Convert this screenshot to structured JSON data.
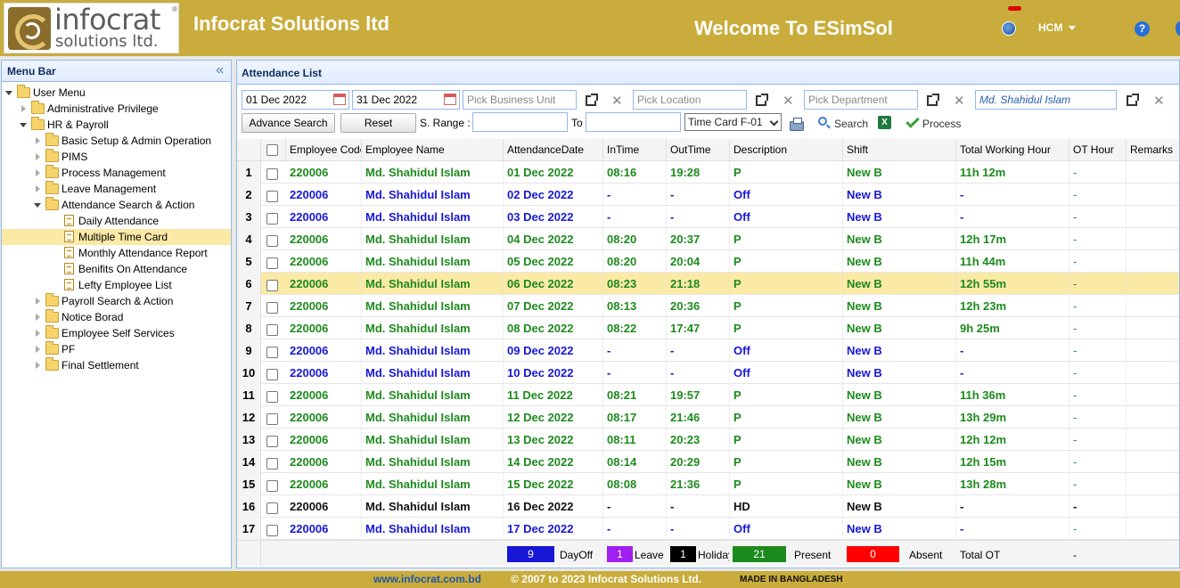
{
  "header": {
    "logo_line1": "infocrat",
    "logo_line2": "solutions ltd.",
    "logo_reg": "®",
    "company": "Infocrat Solutions ltd",
    "welcome": "Welcome To ESimSol",
    "user": "HCM",
    "help": "?"
  },
  "sidebar": {
    "title": "Menu Bar",
    "collapse": "«",
    "items": [
      {
        "label": "User Menu",
        "level": 0,
        "type": "folder",
        "state": "open"
      },
      {
        "label": "Administrative Privilege",
        "level": 1,
        "type": "folder",
        "state": "closed"
      },
      {
        "label": "HR & Payroll",
        "level": 1,
        "type": "folder",
        "state": "open"
      },
      {
        "label": "Basic Setup & Admin Operation",
        "level": 2,
        "type": "folder",
        "state": "closed"
      },
      {
        "label": "PIMS",
        "level": 2,
        "type": "folder",
        "state": "closed"
      },
      {
        "label": "Process Management",
        "level": 2,
        "type": "folder",
        "state": "closed"
      },
      {
        "label": "Leave Management",
        "level": 2,
        "type": "folder",
        "state": "closed"
      },
      {
        "label": "Attendance Search & Action",
        "level": 2,
        "type": "folder",
        "state": "open"
      },
      {
        "label": "Daily Attendance",
        "level": 3,
        "type": "page"
      },
      {
        "label": "Multiple Time Card",
        "level": 3,
        "type": "page",
        "selected": true
      },
      {
        "label": "Monthly Attendance Report",
        "level": 3,
        "type": "page"
      },
      {
        "label": "Benifits On Attendance",
        "level": 3,
        "type": "page"
      },
      {
        "label": "Lefty Employee List",
        "level": 3,
        "type": "page"
      },
      {
        "label": "Payroll Search & Action",
        "level": 2,
        "type": "folder",
        "state": "closed"
      },
      {
        "label": "Notice Borad",
        "level": 2,
        "type": "folder",
        "state": "closed"
      },
      {
        "label": "Employee Self Services",
        "level": 2,
        "type": "folder",
        "state": "closed"
      },
      {
        "label": "PF",
        "level": 2,
        "type": "folder",
        "state": "closed"
      },
      {
        "label": "Final Settlement",
        "level": 2,
        "type": "folder",
        "state": "closed"
      }
    ]
  },
  "main": {
    "title": "Attendance List",
    "toolbar": {
      "date_from": "01 Dec 2022",
      "date_to": "31 Dec 2022",
      "business_unit_placeholder": "Pick Business Unit",
      "location_placeholder": "Pick Location",
      "department_placeholder": "Pick Department",
      "employee": "Md. Shahidul Islam",
      "clear": "✕",
      "advance_search": "Advance Search",
      "reset": "Reset",
      "s_range_label": "S. Range :",
      "to_label": "To",
      "time_card": "Time Card F-01",
      "search": "Search",
      "excel": "X",
      "process": "Process"
    },
    "columns": [
      "Employee Code",
      "Employee Name",
      "AttendanceDate",
      "InTime",
      "OutTime",
      "Description",
      "Shift",
      "Total Working Hour",
      "OT Hour",
      "Remarks"
    ],
    "rows": [
      {
        "n": "1",
        "code": "220006",
        "name": "Md. Shahidul Islam",
        "date": "01 Dec 2022",
        "in": "08:16",
        "out": "19:28",
        "desc": "P",
        "shift": "New B",
        "twh": "11h 12m",
        "ot": "-",
        "remarks": "",
        "color": "green"
      },
      {
        "n": "2",
        "code": "220006",
        "name": "Md. Shahidul Islam",
        "date": "02 Dec 2022",
        "in": "-",
        "out": "-",
        "desc": "Off",
        "shift": "New B",
        "twh": "-",
        "ot": "-",
        "remarks": "",
        "color": "blue"
      },
      {
        "n": "3",
        "code": "220006",
        "name": "Md. Shahidul Islam",
        "date": "03 Dec 2022",
        "in": "-",
        "out": "-",
        "desc": "Off",
        "shift": "New B",
        "twh": "-",
        "ot": "-",
        "remarks": "",
        "color": "blue"
      },
      {
        "n": "4",
        "code": "220006",
        "name": "Md. Shahidul Islam",
        "date": "04 Dec 2022",
        "in": "08:20",
        "out": "20:37",
        "desc": "P",
        "shift": "New B",
        "twh": "12h 17m",
        "ot": "-",
        "remarks": "",
        "color": "green"
      },
      {
        "n": "5",
        "code": "220006",
        "name": "Md. Shahidul Islam",
        "date": "05 Dec 2022",
        "in": "08:20",
        "out": "20:04",
        "desc": "P",
        "shift": "New B",
        "twh": "11h 44m",
        "ot": "-",
        "remarks": "",
        "color": "green"
      },
      {
        "n": "6",
        "code": "220006",
        "name": "Md. Shahidul Islam",
        "date": "06 Dec 2022",
        "in": "08:23",
        "out": "21:18",
        "desc": "P",
        "shift": "New B",
        "twh": "12h 55m",
        "ot": "-",
        "remarks": "",
        "color": "green",
        "selected": true
      },
      {
        "n": "7",
        "code": "220006",
        "name": "Md. Shahidul Islam",
        "date": "07 Dec 2022",
        "in": "08:13",
        "out": "20:36",
        "desc": "P",
        "shift": "New B",
        "twh": "12h 23m",
        "ot": "-",
        "remarks": "",
        "color": "green"
      },
      {
        "n": "8",
        "code": "220006",
        "name": "Md. Shahidul Islam",
        "date": "08 Dec 2022",
        "in": "08:22",
        "out": "17:47",
        "desc": "P",
        "shift": "New B",
        "twh": "9h 25m",
        "ot": "-",
        "remarks": "",
        "color": "green"
      },
      {
        "n": "9",
        "code": "220006",
        "name": "Md. Shahidul Islam",
        "date": "09 Dec 2022",
        "in": "-",
        "out": "-",
        "desc": "Off",
        "shift": "New B",
        "twh": "-",
        "ot": "-",
        "remarks": "",
        "color": "blue"
      },
      {
        "n": "10",
        "code": "220006",
        "name": "Md. Shahidul Islam",
        "date": "10 Dec 2022",
        "in": "-",
        "out": "-",
        "desc": "Off",
        "shift": "New B",
        "twh": "-",
        "ot": "-",
        "remarks": "",
        "color": "blue"
      },
      {
        "n": "11",
        "code": "220006",
        "name": "Md. Shahidul Islam",
        "date": "11 Dec 2022",
        "in": "08:21",
        "out": "19:57",
        "desc": "P",
        "shift": "New B",
        "twh": "11h 36m",
        "ot": "-",
        "remarks": "",
        "color": "green"
      },
      {
        "n": "12",
        "code": "220006",
        "name": "Md. Shahidul Islam",
        "date": "12 Dec 2022",
        "in": "08:17",
        "out": "21:46",
        "desc": "P",
        "shift": "New B",
        "twh": "13h 29m",
        "ot": "-",
        "remarks": "",
        "color": "green"
      },
      {
        "n": "13",
        "code": "220006",
        "name": "Md. Shahidul Islam",
        "date": "13 Dec 2022",
        "in": "08:11",
        "out": "20:23",
        "desc": "P",
        "shift": "New B",
        "twh": "12h 12m",
        "ot": "-",
        "remarks": "",
        "color": "green"
      },
      {
        "n": "14",
        "code": "220006",
        "name": "Md. Shahidul Islam",
        "date": "14 Dec 2022",
        "in": "08:14",
        "out": "20:29",
        "desc": "P",
        "shift": "New B",
        "twh": "12h 15m",
        "ot": "-",
        "remarks": "",
        "color": "green"
      },
      {
        "n": "15",
        "code": "220006",
        "name": "Md. Shahidul Islam",
        "date": "15 Dec 2022",
        "in": "08:08",
        "out": "21:36",
        "desc": "P",
        "shift": "New B",
        "twh": "13h 28m",
        "ot": "-",
        "remarks": "",
        "color": "green"
      },
      {
        "n": "16",
        "code": "220006",
        "name": "Md. Shahidul Islam",
        "date": "16 Dec 2022",
        "in": "-",
        "out": "-",
        "desc": "HD",
        "shift": "New B",
        "twh": "-",
        "ot": "-",
        "remarks": "",
        "color": "black"
      },
      {
        "n": "17",
        "code": "220006",
        "name": "Md. Shahidul Islam",
        "date": "17 Dec 2022",
        "in": "-",
        "out": "-",
        "desc": "Off",
        "shift": "New B",
        "twh": "-",
        "ot": "-",
        "remarks": "",
        "color": "blue"
      }
    ],
    "summary": {
      "dayoff_count": "9",
      "dayoff_label": "DayOff",
      "leave_count": "1",
      "leave_label": "Leave",
      "holiday_count": "1",
      "holiday_label": "Holiday",
      "present_count": "21",
      "present_label": "Present",
      "absent_count": "0",
      "absent_label": "Absent",
      "total_ot_label": "Total OT",
      "total_ot_value": "-"
    }
  },
  "footer": {
    "link": "www.infocrat.com.bd",
    "copyright": "© 2007 to 2023 Infocrat Solutions Ltd.",
    "made": "MADE IN BANGLADESH"
  },
  "colors": {
    "brand": "#c9ac3b",
    "present": "#1d8a1d",
    "dayoff": "#1717d6",
    "leave": "#a020f0",
    "holiday": "#000000",
    "absent": "#ff0000",
    "selected_row": "#fbe9a6"
  }
}
